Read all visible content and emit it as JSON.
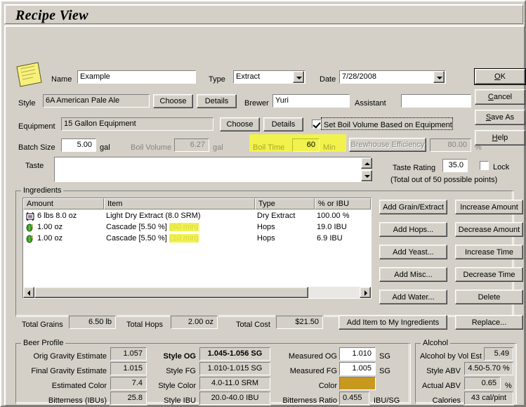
{
  "window": {
    "title": "Recipe View"
  },
  "header": {
    "name_label": "Name",
    "name_value": "Example",
    "type_label": "Type",
    "type_value": "Extract",
    "date_label": "Date",
    "date_value": "7/28/2008",
    "style_label": "Style",
    "style_value": "6A American Pale Ale",
    "style_choose": "Choose",
    "style_details": "Details",
    "brewer_label": "Brewer",
    "brewer_value": "Yuri",
    "assistant_label": "Assistant",
    "assistant_value": "",
    "equipment_label": "Equipment",
    "equipment_value": "15 Gallon Equipment",
    "equipment_choose": "Choose",
    "equipment_details": "Details",
    "set_boil_volume_label": "Set Boil Volume Based on Equipment",
    "set_boil_volume_checked": true,
    "batch_size_label": "Batch Size",
    "batch_size_value": "5.00",
    "batch_size_unit": "gal",
    "boil_volume_label": "Boil Volume",
    "boil_volume_value": "6.27",
    "boil_volume_unit": "gal",
    "boil_time_label": "Boil Time",
    "boil_time_value": "60",
    "boil_time_unit": "Min",
    "brewhouse_efficiency_label": "Brewhouse Efficiency",
    "brewhouse_efficiency_value": "80.00",
    "brewhouse_efficiency_unit": "%",
    "taste_label": "Taste",
    "taste_value": "",
    "taste_rating_label": "Taste Rating",
    "taste_rating_value": "35.0",
    "lock_label": "Lock",
    "lock_checked": false,
    "taste_note": "(Total out of 50 possible points)"
  },
  "dialog_buttons": {
    "ok": "OK",
    "ok_mnemonic": "O",
    "cancel": "Cancel",
    "cancel_mnemonic": "C",
    "save_as": "Save As",
    "save_as_mnemonic": "S",
    "help": "Help",
    "help_mnemonic": "H"
  },
  "ingredients": {
    "group_title": "Ingredients",
    "columns": [
      "Amount",
      "Item",
      "Type",
      "% or IBU"
    ],
    "rows": [
      {
        "icon": "grain-bag-icon",
        "amount": "6 lbs 8.0 oz",
        "item": "Light Dry Extract (8.0 SRM)",
        "time": "",
        "type": "Dry Extract",
        "pct": "100.00 %"
      },
      {
        "icon": "hop-cone-icon",
        "amount": "1.00 oz",
        "item": "Cascade [5.50 %]",
        "time": "(60 min)",
        "type": "Hops",
        "pct": "19.0 IBU"
      },
      {
        "icon": "hop-cone-icon",
        "amount": "1.00 oz",
        "item": "Cascade [5.50 %]",
        "time": "(10 min)",
        "type": "Hops",
        "pct": "6.9 IBU"
      }
    ],
    "buttons_left": [
      "Add Grain/Extract",
      "Add Hops...",
      "Add Yeast...",
      "Add Misc...",
      "Add Water..."
    ],
    "buttons_right": [
      "Increase Amount",
      "Decrease Amount",
      "Increase Time",
      "Decrease Time",
      "Delete"
    ],
    "add_item_button": "Add Item to My Ingredients",
    "replace_button": "Replace...",
    "totals": {
      "grains_label": "Total Grains",
      "grains_value": "6.50 lb",
      "hops_label": "Total Hops",
      "hops_value": "2.00 oz",
      "cost_label": "Total Cost",
      "cost_value": "$21.50"
    }
  },
  "beer_profile": {
    "group_title": "Beer Profile",
    "rows": [
      {
        "label": "Orig Gravity Estimate",
        "value": "1.057",
        "style_label": "Style OG",
        "style_value": "1.045-1.056 SG",
        "style_bold": true,
        "meas_label": "Measured OG",
        "meas_value": "1.010",
        "meas_unit": "SG"
      },
      {
        "label": "Final Gravity Estimate",
        "value": "1.015",
        "style_label": "Style FG",
        "style_value": "1.010-1.015 SG",
        "style_bold": false,
        "meas_label": "Measured FG",
        "meas_value": "1.005",
        "meas_unit": "SG"
      },
      {
        "label": "Estimated Color",
        "value": "7.4",
        "style_label": "Style Color",
        "style_value": "4.0-11.0 SRM",
        "style_bold": false,
        "meas_label": "Color",
        "meas_value": "",
        "meas_unit": ""
      },
      {
        "label": "Bitterness (IBUs)",
        "value": "25.8",
        "style_label": "Style IBU",
        "style_value": "20.0-40.0 IBU",
        "style_bold": false,
        "meas_label": "Bitterness Ratio",
        "meas_value": "0.455",
        "meas_unit": "IBU/SG"
      }
    ],
    "color_swatch": "#c8991f"
  },
  "alcohol": {
    "group_title": "Alcohol",
    "rows": [
      {
        "label": "Alcohol by Vol Est",
        "value": "5.49",
        "unit": ""
      },
      {
        "label": "Style ABV",
        "value": "4.50-5.70 %",
        "unit": ""
      },
      {
        "label": "Actual ABV",
        "value": "0.65",
        "unit": "%"
      },
      {
        "label": "Calories",
        "value": "43 cal/pint",
        "unit": ""
      }
    ]
  },
  "colors": {
    "face": "#d4d0c8",
    "highlight_yellow": "#f2f24d",
    "highlight_text": "#d8d84a",
    "boil_time_text": "#a6a62e",
    "disabled_text": "#868482"
  }
}
